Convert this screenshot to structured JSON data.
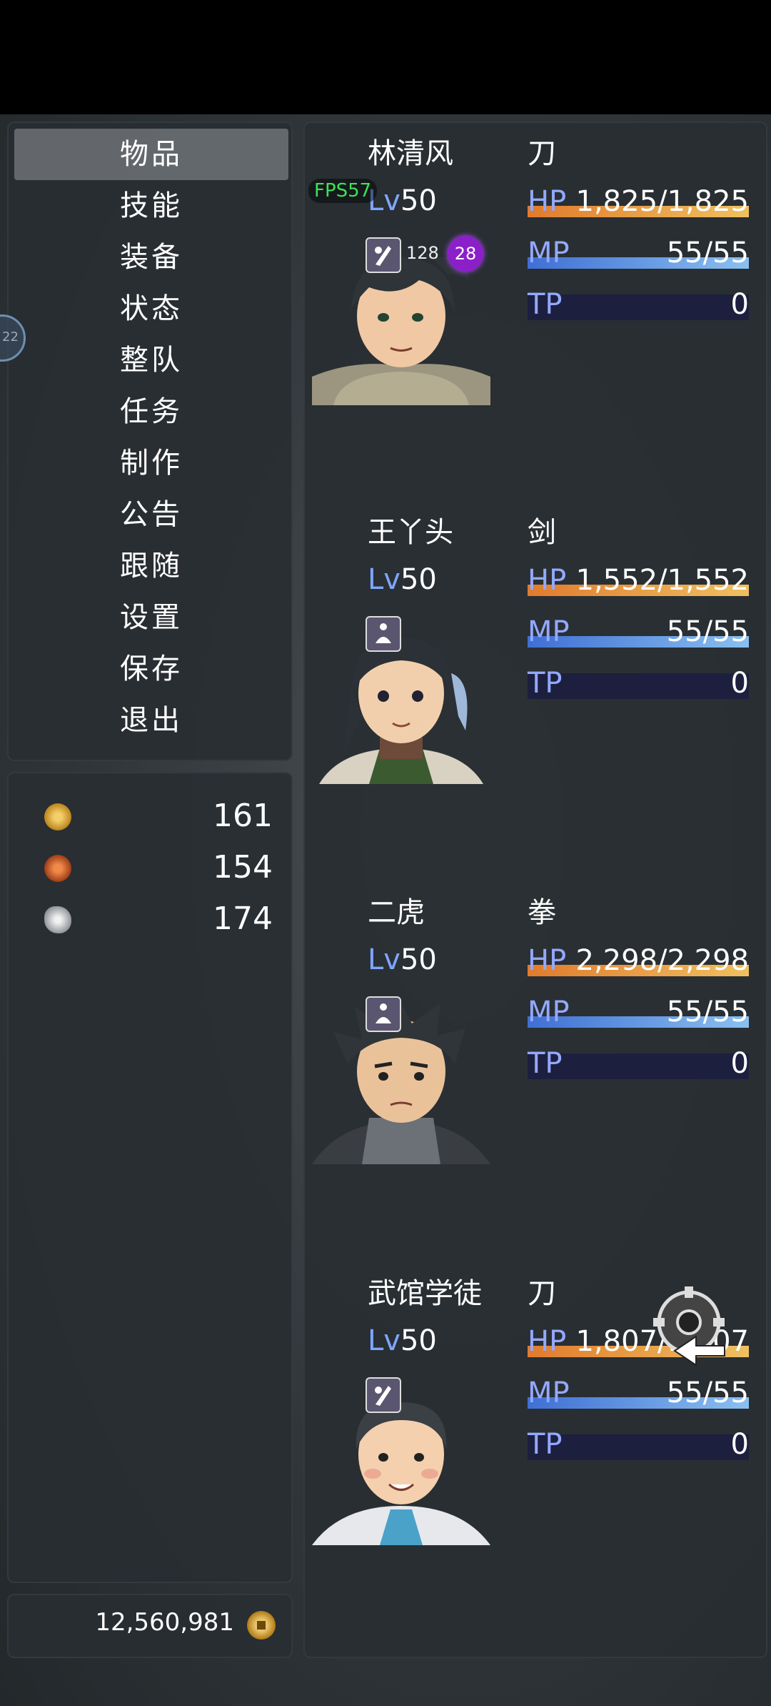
{
  "menu": {
    "items": [
      "物品",
      "技能",
      "装备",
      "状态",
      "整队",
      "任务",
      "制作",
      "公告",
      "跟随",
      "设置",
      "保存",
      "退出"
    ],
    "selected_index": 0
  },
  "resources": [
    {
      "icon": "iron-ore-icon",
      "value": "161",
      "color": "#d9a62e"
    },
    {
      "icon": "copper-ore-icon",
      "value": "154",
      "color": "#c8561f"
    },
    {
      "icon": "silver-ore-icon",
      "value": "174",
      "color": "#bfc3c8"
    }
  ],
  "gold": {
    "value": "12,560,981",
    "icon": "coin-icon"
  },
  "overlay": {
    "fps": "FPS57",
    "edge_label": "22"
  },
  "party": [
    {
      "name": "林清风",
      "weapon": "刀",
      "lv_label": "Lv",
      "lv": "50",
      "hp_label": "HP",
      "hp": "1,825/1,825",
      "hp_rate": 1.0,
      "mp_label": "MP",
      "mp": "55/55",
      "mp_rate": 1.0,
      "tp_label": "TP",
      "tp": "0",
      "tp_rate": 0,
      "buff_count": "128",
      "buff_level": "28",
      "state_icon": "blade-stance-icon"
    },
    {
      "name": "王丫头",
      "weapon": "剑",
      "lv_label": "Lv",
      "lv": "50",
      "hp_label": "HP",
      "hp": "1,552/1,552",
      "hp_rate": 1.0,
      "mp_label": "MP",
      "mp": "55/55",
      "mp_rate": 1.0,
      "tp_label": "TP",
      "tp": "0",
      "tp_rate": 0,
      "state_icon": "meditation-icon"
    },
    {
      "name": "二虎",
      "weapon": "拳",
      "lv_label": "Lv",
      "lv": "50",
      "hp_label": "HP",
      "hp": "2,298/2,298",
      "hp_rate": 1.0,
      "mp_label": "MP",
      "mp": "55/55",
      "mp_rate": 1.0,
      "tp_label": "TP",
      "tp": "0",
      "tp_rate": 0,
      "state_icon": "meditation-icon"
    },
    {
      "name": "武馆学徒",
      "weapon": "刀",
      "lv_label": "Lv",
      "lv": "50",
      "hp_label": "HP",
      "hp": "1,807/1,807",
      "hp_rate": 1.0,
      "mp_label": "MP",
      "mp": "55/55",
      "mp_rate": 1.0,
      "tp_label": "TP",
      "tp": "0",
      "tp_rate": 0,
      "state_icon": "blade-stance-icon"
    }
  ],
  "colors": {
    "hp": "#e8a040",
    "mp": "#5a94e0",
    "tp_bg": "#1d1f3f",
    "label": "#93a9ff",
    "fps": "#3fe05a"
  }
}
